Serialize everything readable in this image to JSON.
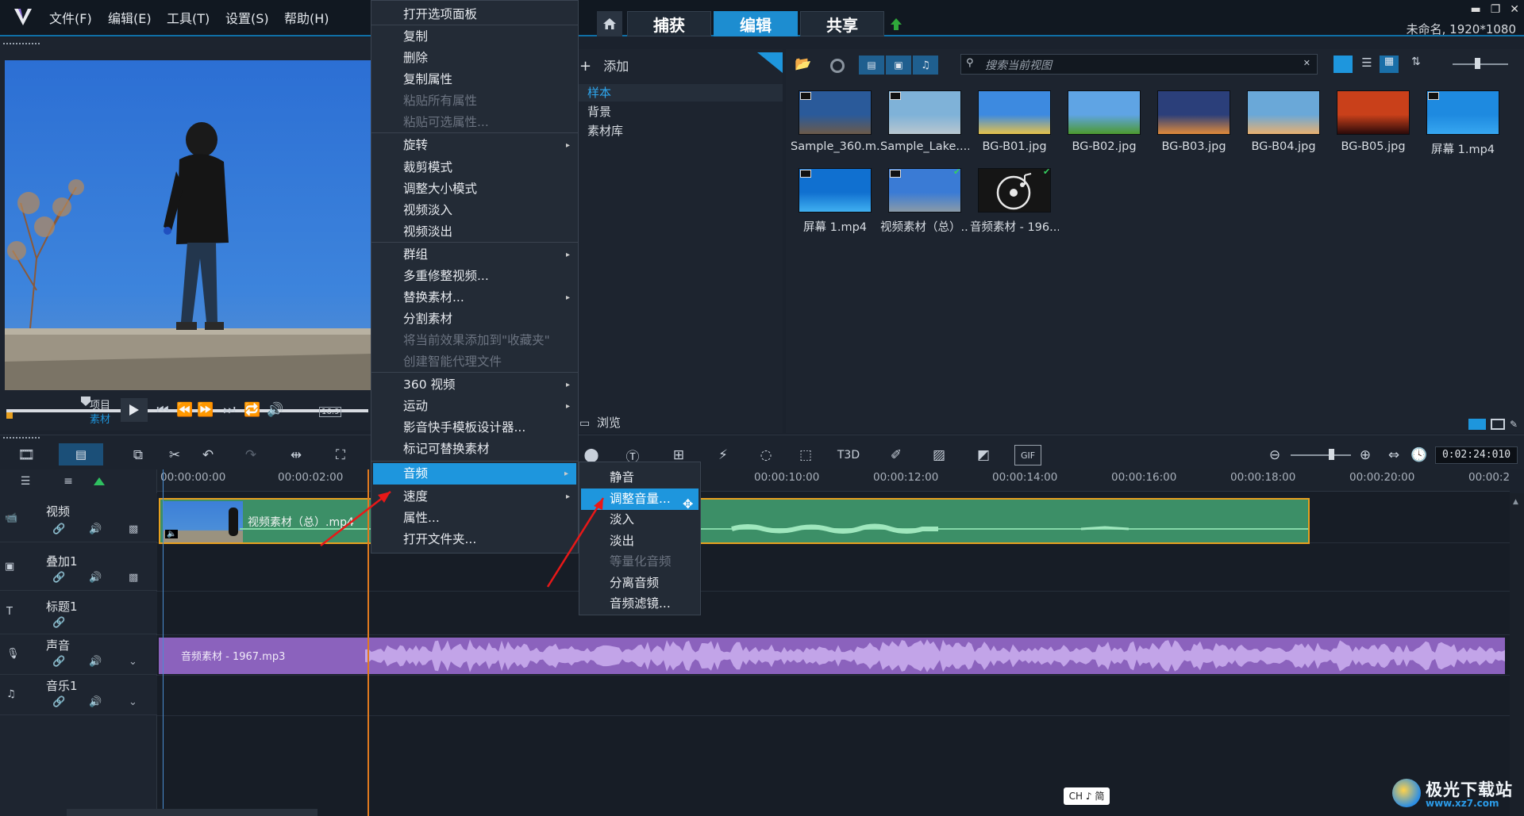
{
  "app": {
    "menus": [
      "文件(F)",
      "编辑(E)",
      "工具(T)",
      "设置(S)",
      "帮助(H)"
    ],
    "project_info": "未命名, 1920*1080",
    "nav_tabs": [
      "捕获",
      "编辑",
      "共享"
    ]
  },
  "preview": {
    "labels": {
      "project": "项目",
      "clip": "素材"
    },
    "aspect": "16:9"
  },
  "context_menu": {
    "items": [
      {
        "label": "打开选项面板",
        "disabled": false,
        "submenu": false
      },
      {
        "label": "复制",
        "disabled": false,
        "submenu": false
      },
      {
        "label": "删除",
        "disabled": false,
        "submenu": false
      },
      {
        "label": "复制属性",
        "disabled": false,
        "submenu": false
      },
      {
        "label": "粘贴所有属性",
        "disabled": true,
        "submenu": false
      },
      {
        "label": "粘贴可选属性...",
        "disabled": true,
        "submenu": false
      },
      {
        "label": "旋转",
        "disabled": false,
        "submenu": true
      },
      {
        "label": "裁剪模式",
        "disabled": false,
        "submenu": false
      },
      {
        "label": "调整大小模式",
        "disabled": false,
        "submenu": false
      },
      {
        "label": "视频淡入",
        "disabled": false,
        "submenu": false
      },
      {
        "label": "视频淡出",
        "disabled": false,
        "submenu": false
      },
      {
        "label": "群组",
        "disabled": false,
        "submenu": true
      },
      {
        "label": "多重修整视频...",
        "disabled": false,
        "submenu": false
      },
      {
        "label": "替换素材...",
        "disabled": false,
        "submenu": true
      },
      {
        "label": "分割素材",
        "disabled": false,
        "submenu": false
      },
      {
        "label": "将当前效果添加到\"收藏夹\"",
        "disabled": true,
        "submenu": false
      },
      {
        "label": "创建智能代理文件",
        "disabled": true,
        "submenu": false
      },
      {
        "label": "360 视频",
        "disabled": false,
        "submenu": true
      },
      {
        "label": "运动",
        "disabled": false,
        "submenu": true
      },
      {
        "label": "影音快手模板设计器...",
        "disabled": false,
        "submenu": false
      },
      {
        "label": "标记可替换素材",
        "disabled": false,
        "submenu": false
      },
      {
        "label": "音频",
        "disabled": false,
        "submenu": true,
        "highlighted": true
      },
      {
        "label": "速度",
        "disabled": false,
        "submenu": true
      },
      {
        "label": "属性...",
        "disabled": false,
        "submenu": false
      },
      {
        "label": "打开文件夹...",
        "disabled": false,
        "submenu": false
      }
    ],
    "submenu": [
      {
        "label": "静音",
        "disabled": false
      },
      {
        "label": "调整音量...",
        "disabled": false,
        "highlighted": true
      },
      {
        "label": "淡入",
        "disabled": false
      },
      {
        "label": "淡出",
        "disabled": false
      },
      {
        "label": "等量化音频",
        "disabled": true
      },
      {
        "label": "分离音频",
        "disabled": false
      },
      {
        "label": "音频滤镜...",
        "disabled": false
      }
    ]
  },
  "library": {
    "add_label": "添加",
    "tree": [
      "样本",
      "背景",
      "素材库"
    ],
    "browse_label": "浏览",
    "search_placeholder": "搜索当前视图",
    "thumbnails": [
      {
        "caption": "Sample_360.m...",
        "color1": "#2a5a9a",
        "color2": "#6b5a4a",
        "video": true
      },
      {
        "caption": "Sample_Lake....",
        "color1": "#7fb2d8",
        "color2": "#b8c6cf",
        "video": true
      },
      {
        "caption": "BG-B01.jpg",
        "color1": "#3d8ae0",
        "color2": "#e6c24a",
        "video": false
      },
      {
        "caption": "BG-B02.jpg",
        "color1": "#5fa4e4",
        "color2": "#4d9a2e",
        "video": false
      },
      {
        "caption": "BG-B03.jpg",
        "color1": "#2b3f7a",
        "color2": "#e08a3a",
        "video": false
      },
      {
        "caption": "BG-B04.jpg",
        "color1": "#6aa8d8",
        "color2": "#e8b070",
        "video": false
      },
      {
        "caption": "BG-B05.jpg",
        "color1": "#c9401a",
        "color2": "#2a0a0a",
        "video": false
      },
      {
        "caption": "屏幕 1.mp4",
        "color1": "#1e8ae0",
        "color2": "#36a6f0",
        "video": true
      },
      {
        "caption": "屏幕 1.mp4",
        "color1": "#1070d0",
        "color2": "#40b0f0",
        "video": true
      },
      {
        "caption": "视频素材（总）....",
        "color1": "#3a7bd5",
        "color2": "#8a9aa8",
        "video": true,
        "checked": true
      },
      {
        "caption": "音频素材 - 196...",
        "color1": "#1a1a1a",
        "color2": "#1a1a1a",
        "video": false,
        "audio": true,
        "checked": true
      }
    ]
  },
  "timeline": {
    "timecode": "0:02:24:010",
    "ruler": [
      "00:00:00:00",
      "00:00:02:00",
      "00:00:10:00",
      "00:00:12:00",
      "00:00:14:00",
      "00:00:16:00",
      "00:00:18:00",
      "00:00:20:00",
      "00:00:2"
    ],
    "tracks": [
      "视频",
      "叠加1",
      "标题1",
      "声音",
      "音乐1"
    ],
    "video_clip_label": "视频素材（总）.mp4",
    "audio_clip_label": "音频素材 - 1967.mp3"
  },
  "ime": "CH ♪ 简",
  "watermark": {
    "name": "极光下载站",
    "url": "www.xz7.com"
  },
  "colors": {
    "accent": "#1e96dd",
    "video_clip": "#3c8f67",
    "audio_clip": "#8b62bd",
    "playhead": "#e07a1f"
  }
}
